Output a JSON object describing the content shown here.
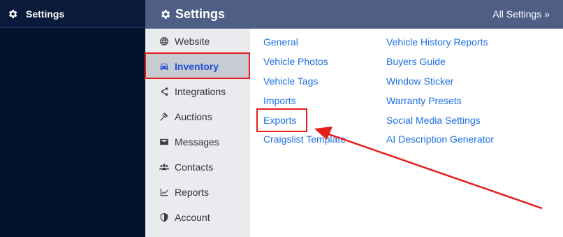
{
  "sidebar_header": {
    "title": "Settings",
    "icon": "gear-icon"
  },
  "top_bar": {
    "title": "Settings",
    "all_settings_link": "All Settings »",
    "icon": "gear-icon"
  },
  "nav": {
    "items": [
      {
        "label": "Website",
        "icon": "globe-icon"
      },
      {
        "label": "Inventory",
        "icon": "car-icon",
        "active": true
      },
      {
        "label": "Integrations",
        "icon": "share-icon"
      },
      {
        "label": "Auctions",
        "icon": "gavel-icon"
      },
      {
        "label": "Messages",
        "icon": "envelope-icon"
      },
      {
        "label": "Contacts",
        "icon": "users-icon"
      },
      {
        "label": "Reports",
        "icon": "chart-line-icon"
      },
      {
        "label": "Account",
        "icon": "shield-icon"
      }
    ]
  },
  "links": {
    "col1": [
      "General",
      "Vehicle Photos",
      "Vehicle Tags",
      "Imports",
      "Exports",
      "Craigslist Template"
    ],
    "col2": [
      "Vehicle History Reports",
      "Buyers Guide",
      "Window Sticker",
      "Warranty Presets",
      "Social Media Settings",
      "AI Description Generator"
    ]
  },
  "annotations": {
    "highlight_color": "#e41d1d",
    "highlighted": [
      "Inventory",
      "Exports"
    ]
  },
  "colors": {
    "accent_link": "#1d6fe8",
    "active_nav": "#1f4fd6",
    "top_bar_bg": "#4e5e85",
    "sidebar_bg": "#03132b"
  }
}
